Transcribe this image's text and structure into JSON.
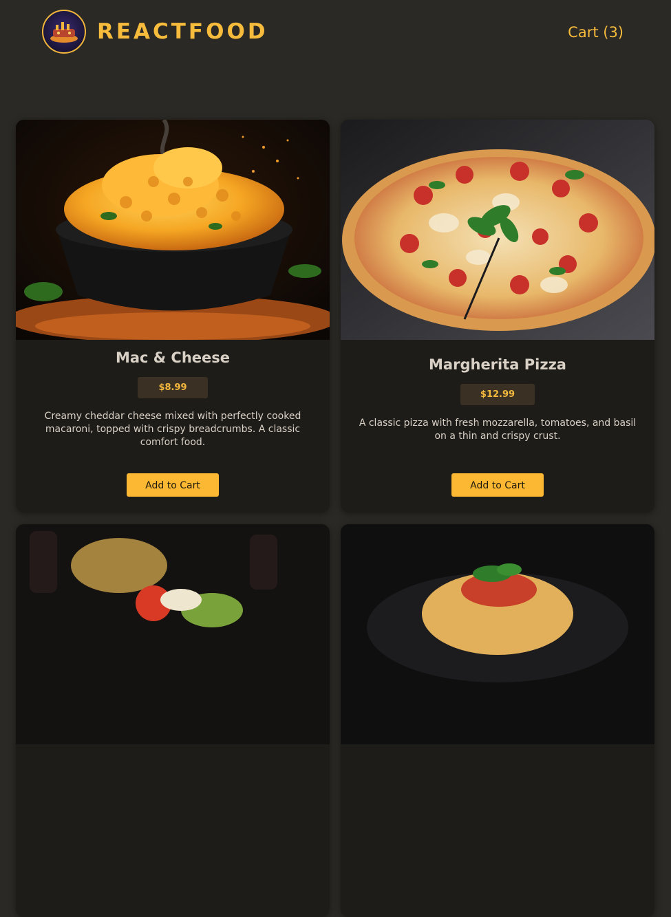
{
  "header": {
    "brand": "REACTFOOD",
    "cart_label": "Cart (3)"
  },
  "meals": [
    {
      "name": "Mac & Cheese",
      "price": "$8.99",
      "description": "Creamy cheddar cheese mixed with perfectly cooked macaroni, topped with crispy breadcrumbs. A classic comfort food.",
      "button": "Add to Cart"
    },
    {
      "name": "Margherita Pizza",
      "price": "$12.99",
      "description": "A classic pizza with fresh mozzarella, tomatoes, and basil on a thin and crispy crust.",
      "button": "Add to Cart"
    }
  ],
  "colors": {
    "accent": "#f8bc3c",
    "button": "#fcb832",
    "page_bg": "#2b2925",
    "card_bg": "#1e1c19"
  }
}
